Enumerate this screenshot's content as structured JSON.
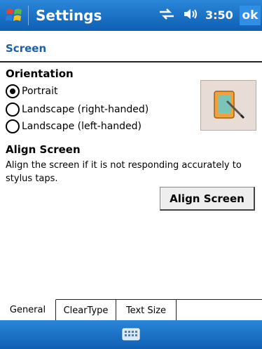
{
  "titlebar": {
    "app_title": "Settings",
    "time": "3:50",
    "ok_label": "ok",
    "icons": [
      "windows-start-icon",
      "connectivity-icon",
      "volume-icon"
    ]
  },
  "page": {
    "header": "Screen"
  },
  "orientation": {
    "title": "Orientation",
    "options": [
      {
        "label": "Portrait",
        "selected": true
      },
      {
        "label": "Landscape (right-handed)",
        "selected": false
      },
      {
        "label": "Landscape (left-handed)",
        "selected": false
      }
    ],
    "image_icon": "screen-orientation-icon"
  },
  "align": {
    "title": "Align Screen",
    "description": "Align the screen if it is not responding accurately to stylus taps.",
    "button_label": "Align Screen"
  },
  "tabs": [
    {
      "label": "General",
      "active": true
    },
    {
      "label": "ClearType",
      "active": false
    },
    {
      "label": "Text Size",
      "active": false
    }
  ],
  "bottombar": {
    "icon": "keyboard-icon"
  },
  "colors": {
    "titlebar": "#1a6fc2",
    "header_text": "#1b5fa8"
  }
}
